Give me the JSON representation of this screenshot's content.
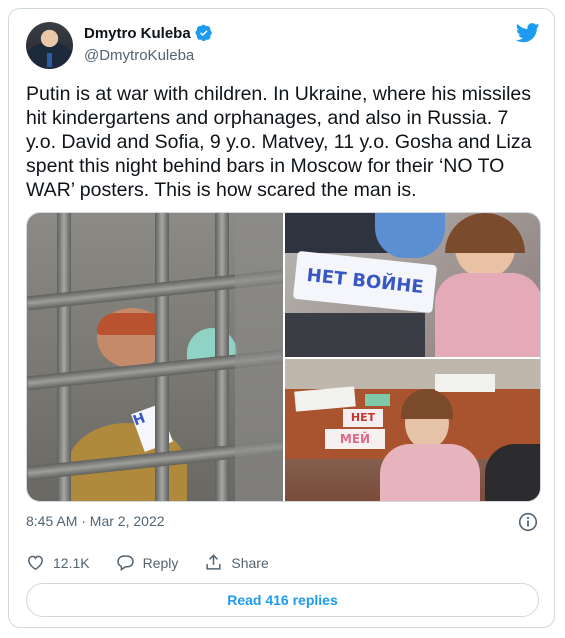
{
  "author": {
    "name": "Dmytro Kuleba",
    "handle": "@DmytroKuleba"
  },
  "tweet": {
    "text": "Putin is at war with children. In Ukraine, where his missiles\nhit kindergartens and orphanages, and also in Russia. 7\ny.o. David and Sofia, 9 y.o. Matvey, 11 y.o. Gosha and Liza\nspent this night behind bars in Moscow for their ‘NO TO\nWAR’ posters. This is how scared the man is."
  },
  "media": {
    "sign_top": "НЕТ ВОЙНЕ",
    "sign_bottom_1": "НЕТ",
    "sign_bottom_2": "МЕЙ"
  },
  "meta": {
    "timestamp": "8:45 AM · Mar 2, 2022"
  },
  "actions": {
    "likes": "12.1K",
    "reply_label": "Reply",
    "share_label": "Share"
  },
  "read_replies": "Read 416 replies",
  "colors": {
    "accent": "#1d9bf0",
    "muted": "#536471",
    "border": "#cfd9de"
  },
  "icons": [
    "verified-badge-icon",
    "twitter-bird-icon",
    "info-icon",
    "heart-icon",
    "reply-bubble-icon",
    "share-icon"
  ]
}
